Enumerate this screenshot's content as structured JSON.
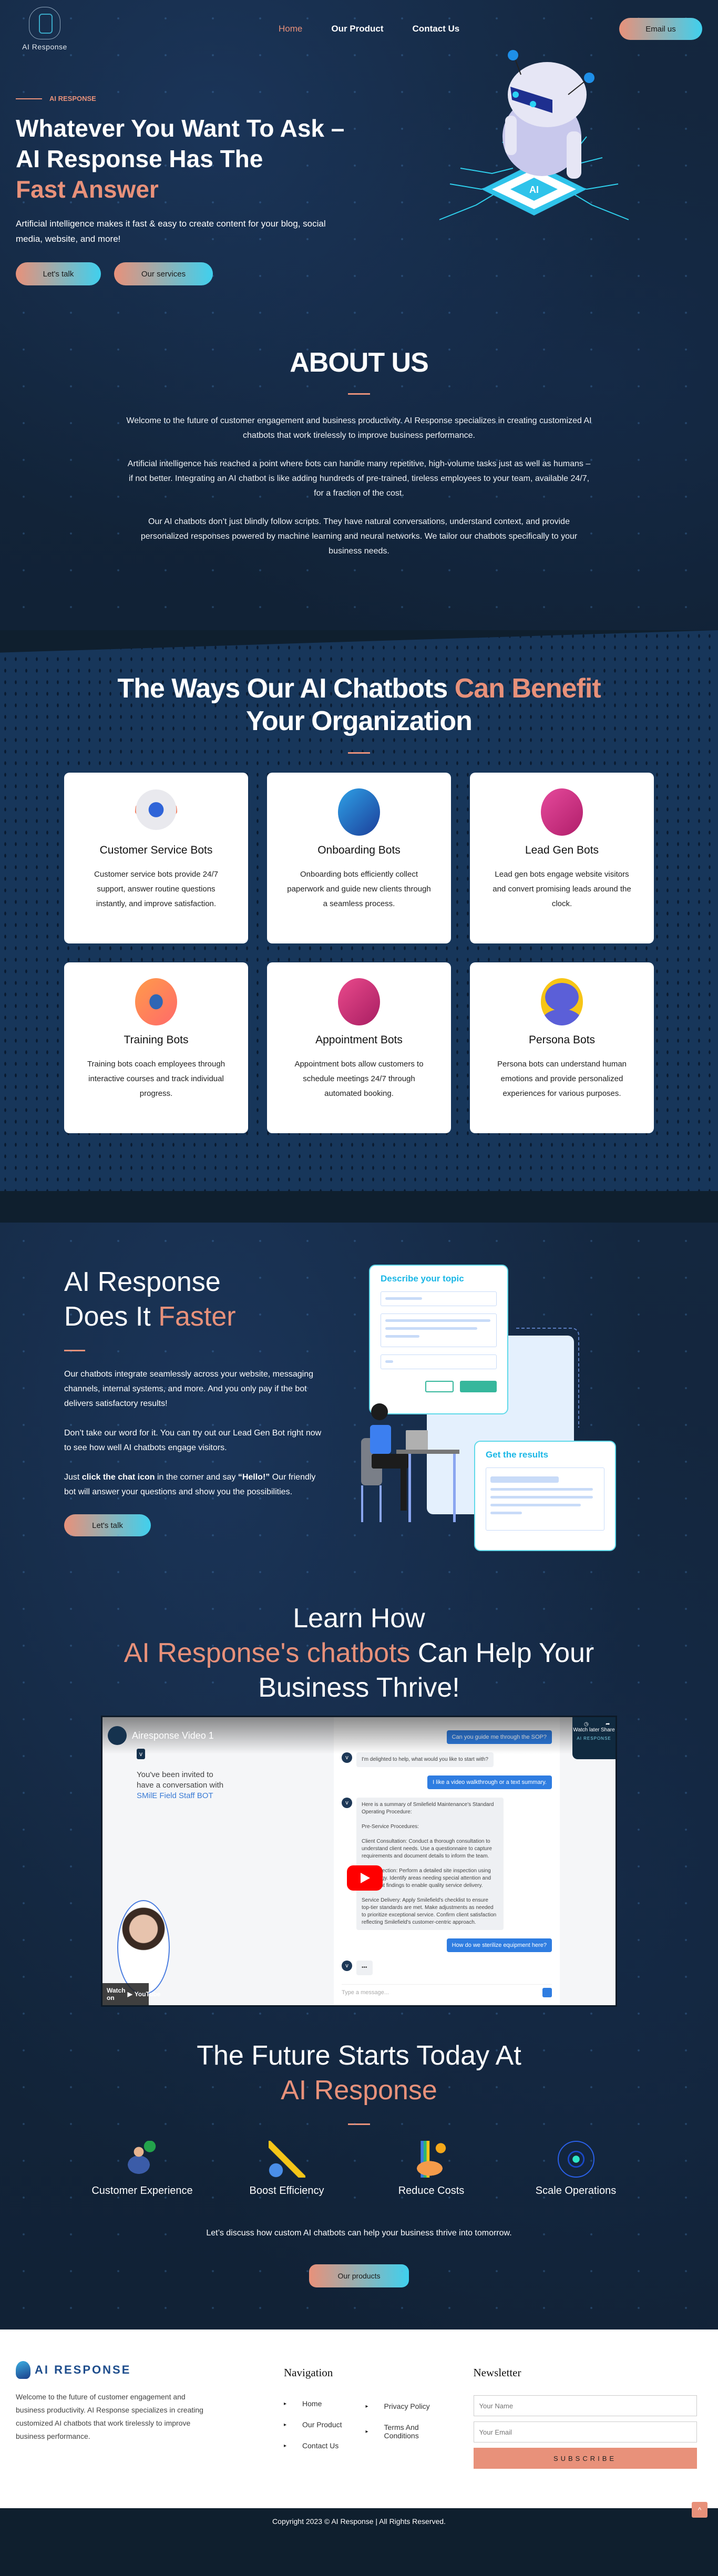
{
  "header": {
    "logo_text": "AI Response",
    "nav": [
      {
        "label": "Home",
        "active": true
      },
      {
        "label": "Our Product",
        "active": false
      },
      {
        "label": "Contact Us",
        "active": false
      }
    ],
    "email_button": "Email us"
  },
  "hero": {
    "kicker": "AI RESPONSE",
    "title_line1": "Whatever You Want To Ask –",
    "title_line2": "AI Response Has The",
    "title_accent": "Fast Answer",
    "description": "Artificial intelligence makes it fast & easy to create content for your blog, social media, website, and more!",
    "btn_talk": "Let's talk",
    "btn_services": "Our services",
    "robot_chip_label": "AI"
  },
  "about": {
    "title": "ABOUT US",
    "paragraphs": [
      "Welcome to the future of customer engagement and business productivity. AI Response specializes in creating customized AI chatbots that work tirelessly to improve business performance.",
      "Artificial intelligence has reached a point where bots can handle many repetitive, high-volume tasks just as well as humans – if not better. Integrating an AI chatbot is like adding hundreds of pre-trained, tireless employees to your team, available 24/7, for a fraction of the cost.",
      "Our AI chatbots don’t just blindly follow scripts. They have natural conversations, understand context, and provide personalized responses powered by machine learning and neural networks. We tailor our chatbots specifically to your business needs."
    ]
  },
  "benefits": {
    "title_white": "The Ways Our AI Chatbots ",
    "title_accent": "Can Benefit",
    "title_line2": "Your Organization",
    "cards": [
      {
        "icon": "headset-robot-icon",
        "title": "Customer Service Bots",
        "text": "Customer service bots provide 24/7 support, answer routine questions instantly, and improve satisfaction."
      },
      {
        "icon": "onboarding-robot-icon",
        "title": "Onboarding Bots",
        "text": "Onboarding bots efficiently collect paperwork and guide new clients through a seamless process."
      },
      {
        "icon": "lead-gen-robot-icon",
        "title": "Lead Gen Bots",
        "text": "Lead gen bots engage website visitors and convert promising leads around the clock."
      },
      {
        "icon": "training-robot-icon",
        "title": "Training Bots",
        "text": "Training bots coach employees through interactive courses and track individual progress."
      },
      {
        "icon": "appointment-robot-icon",
        "title": "Appointment Bots",
        "text": "Appointment bots allow customers to schedule meetings 24/7 through automated booking."
      },
      {
        "icon": "persona-robot-icon",
        "title": "Persona Bots",
        "text": "Persona bots can understand human emotions and provide personalized experiences for various purposes."
      }
    ]
  },
  "faster": {
    "title_line1": "AI Response",
    "title_line2": "Does It ",
    "title_accent": "Faster",
    "p1": "Our chatbots integrate seamlessly across your website, messaging channels, internal systems, and more. And you only pay if the bot delivers satisfactory results!",
    "p2": "Don’t take our word for it. You can try out our Lead Gen Bot right now to see how well AI chatbots engage visitors.",
    "p3_before": "Just ",
    "p3_bold1": "click the chat icon",
    "p3_mid": " in the corner and say ",
    "p3_bold2": "“Hello!”",
    "p3_after": " Our friendly bot will answer your questions and show you the possibilities.",
    "button": "Let's talk",
    "illus_panel1": "Describe your topic",
    "illus_panel2": "Get the results"
  },
  "learn": {
    "title_line1": "Learn How",
    "title_accent": "AI Response's chatbots",
    "title_rest": " Can Help Your",
    "title_line3": "Business Thrive!",
    "video": {
      "title": "Airesponse Video 1",
      "watch_later": "Watch later",
      "share": "Share",
      "brand": "AI RESPONSE",
      "invite_text": "You've been invited to have a conversation with ",
      "invite_bot": "SMilE Field Staff BOT",
      "messages": [
        {
          "from": "user",
          "text": "Can you guide me through the SOP?"
        },
        {
          "from": "bot",
          "text": "I'm delighted to help, what would you like to start with?"
        },
        {
          "from": "user",
          "text": "I like a video walkthrough or a text summary."
        },
        {
          "from": "bot",
          "text": "Here is a summary of Smilefield Maintenance's Standard Operating Procedure:\n\nPre-Service Procedures:\n\nClient Consultation: Conduct a thorough consultation to understand client needs. Use a questionnaire to capture requirements and document details to inform the team.\n\nSite Inspection: Perform a detailed site inspection using technology. Identify areas needing special attention and document findings to enable quality service delivery.\n\nService Delivery: Apply Smilefield's checklist to ensure top-tier standards are met. Make adjustments as needed to prioritize exceptional service. Confirm client satisfaction reflecting Smilefield's customer-centric approach."
        },
        {
          "from": "user",
          "text": "How do we sterilize equipment here?"
        },
        {
          "from": "bot",
          "text": "•••"
        }
      ],
      "input_placeholder": "Type a message...",
      "watch_on": "Watch on",
      "youtube": "YouTube"
    }
  },
  "future": {
    "title_line1": "The Future Starts Today At",
    "title_accent": "AI Response",
    "features": [
      {
        "icon": "customer-rating-icon",
        "label": "Customer Experience"
      },
      {
        "icon": "efficiency-arrow-icon",
        "label": "Boost Efficiency"
      },
      {
        "icon": "cost-hand-icon",
        "label": "Reduce Costs"
      },
      {
        "icon": "scale-gear-icon",
        "label": "Scale Operations"
      }
    ],
    "cta_text": "Let’s discuss how custom AI chatbots can help your business thrive into tomorrow.",
    "button": "Our products"
  },
  "footer": {
    "logo_text": "AI RESPONSE",
    "about": "Welcome to the future of customer engagement and business productivity. AI Response specializes in creating customized AI chatbots that work tirelessly to improve business performance.",
    "nav_title": "Navigation",
    "nav_col1": [
      "Home",
      "Our Product",
      "Contact Us"
    ],
    "nav_col2": [
      "Privacy Policy",
      "Terms And Conditions"
    ],
    "newsletter_title": "Newsletter",
    "name_placeholder": "Your Name",
    "email_placeholder": "Your Email",
    "subscribe": "SUBSCRIBE",
    "copyright": "Copyright 2023 © AI Response | All Rights Reserved.",
    "to_top": "^"
  }
}
